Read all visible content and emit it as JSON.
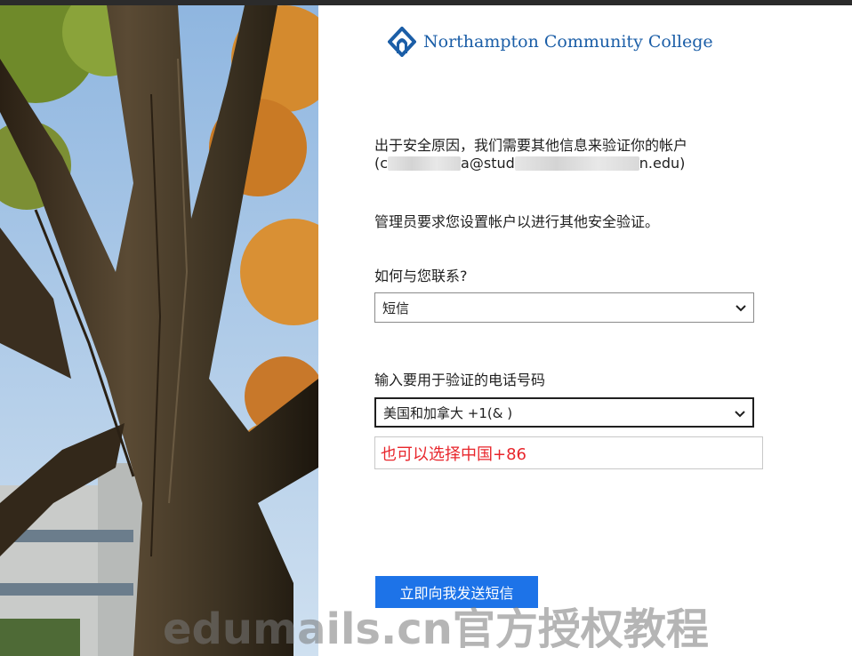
{
  "brand": {
    "name": "Northampton Community College",
    "color": "#1b5ea7"
  },
  "intro": {
    "line1": "出于安全原因，我们需要其他信息来验证你的帐户",
    "email_open": "(c",
    "email_mid": "a@stud",
    "email_end": "n.edu)"
  },
  "admin_message": "管理员要求您设置帐户以进行其他安全验证。",
  "contact_method": {
    "label": "如何与您联系?",
    "selected": "短信"
  },
  "phone": {
    "label": "输入要用于验证的电话号码",
    "country_selected": "美国和加拿大 +1(& )",
    "number_value": "也可以选择中国+86",
    "number_color": "#e8262c"
  },
  "send_button": {
    "label": "立即向我发送短信",
    "color": "#1d73e8"
  },
  "watermark": "edumails.cn官方授权教程",
  "icons": {
    "logo": "ncc-logo-icon",
    "dropdown": "chevron-down-icon"
  }
}
